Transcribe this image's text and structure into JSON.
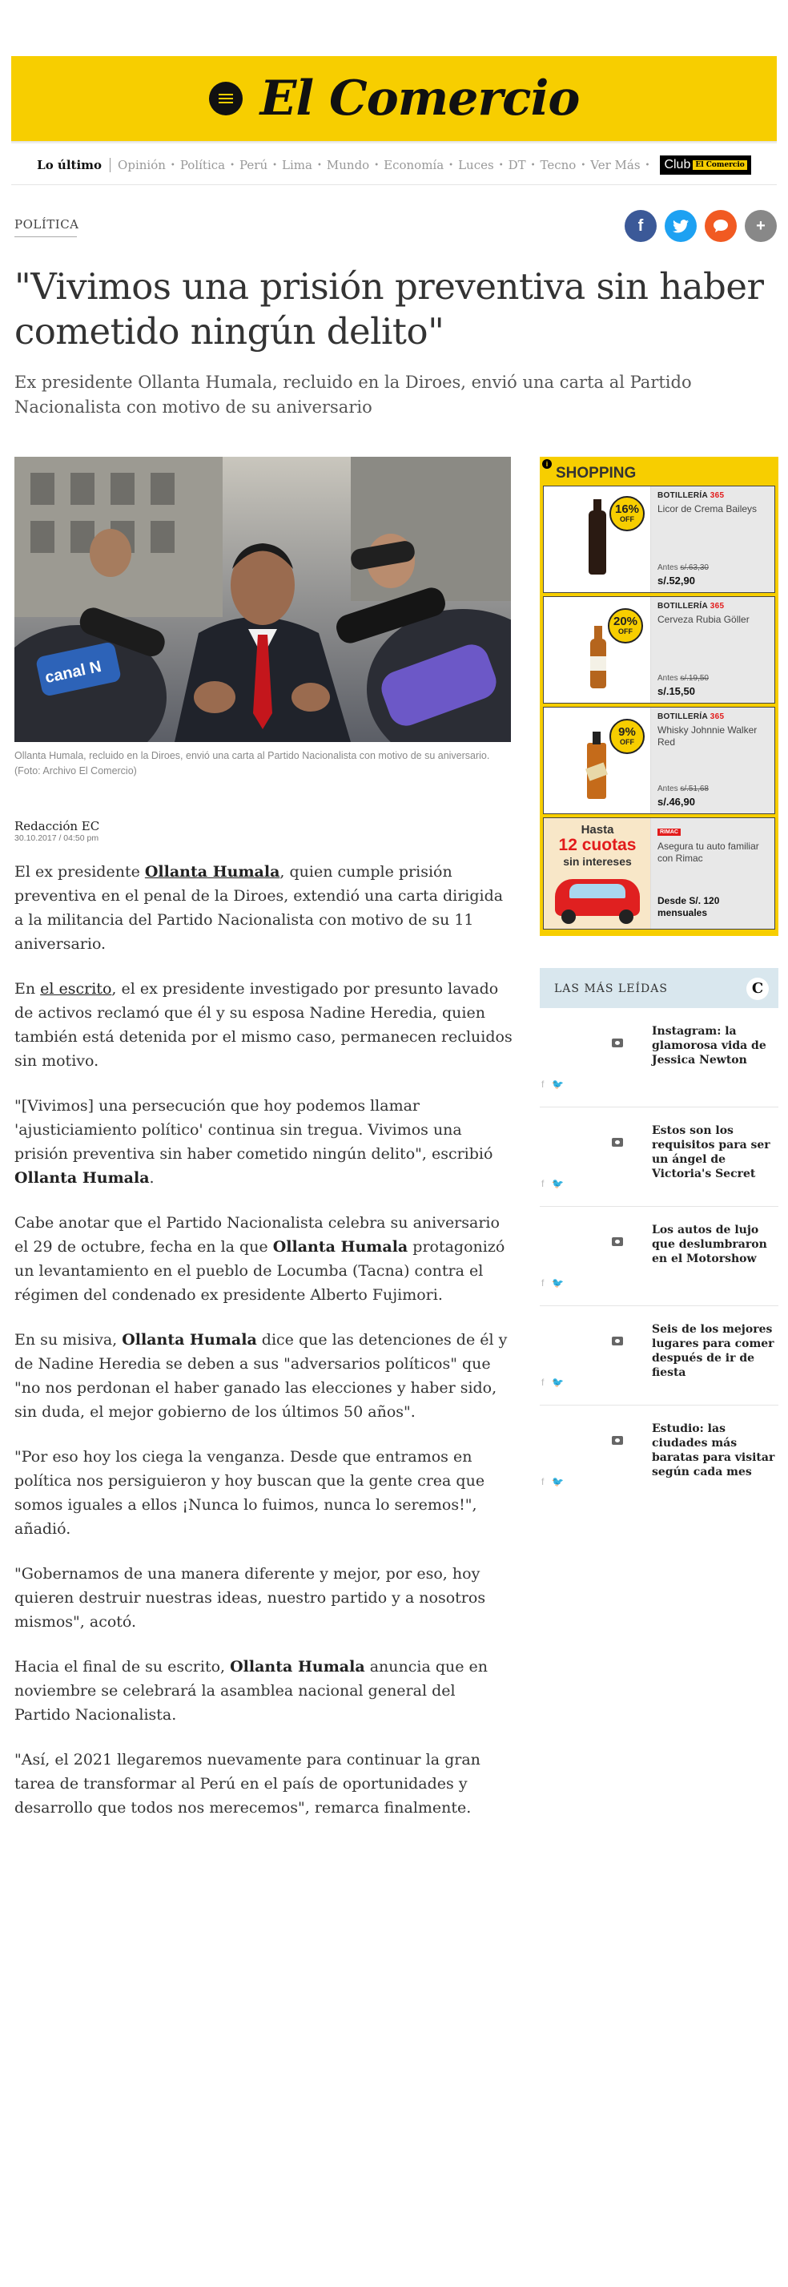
{
  "header": {
    "logo": "El Comercio"
  },
  "nav": {
    "lo_ultimo": "Lo último",
    "items": [
      "Opinión",
      "Política",
      "Perú",
      "Lima",
      "Mundo",
      "Economía",
      "Luces",
      "DT",
      "Tecno",
      "Ver Más"
    ],
    "club": "Club",
    "club_sub": "El Comercio"
  },
  "article": {
    "section": "POLÍTICA",
    "title": "\"Vivimos una prisión preventiva sin haber cometido ningún delito\"",
    "subtitle": "Ex presidente Ollanta Humala, recluido en la Diroes, envió una carta al Partido Nacionalista con motivo de su aniversario",
    "caption": "Ollanta Humala, recluido en la Diroes, envió una carta al Partido Nacionalista con motivo de su aniversario. (Foto: Archivo El Comercio)",
    "image_badge": "canal N",
    "author": "Redacción EC",
    "date": "30.10.2017 / 04:50 pm",
    "p1_a": "El ex presidente ",
    "p1_link": "Ollanta Humala",
    "p1_b": ", quien cumple prisión preventiva en el penal de la Diroes, extendió una carta dirigida a la militancia del Partido Nacionalista con motivo de su 11 aniversario.",
    "p2_a": "En ",
    "p2_link": "el escrito",
    "p2_b": ", el ex presidente investigado por presunto lavado de activos reclamó que él y su esposa Nadine Heredia, quien también está detenida por el mismo caso, permanecen recluidos sin motivo.",
    "p3_a": "\"[Vivimos] una persecución que hoy podemos llamar 'ajusticiamiento político' continua sin tregua. Vivimos una prisión preventiva sin haber cometido ningún delito\", escribió ",
    "p3_bold": "Ollanta Humala",
    "p3_b": ".",
    "p4_a": "Cabe anotar que el Partido Nacionalista celebra su aniversario el 29 de octubre, fecha en la que ",
    "p4_bold": "Ollanta Humala",
    "p4_b": " protagonizó un levantamiento en el pueblo de Locumba (Tacna) contra el régimen del condenado ex presidente Alberto Fujimori.",
    "p5_a": "En su misiva, ",
    "p5_bold": "Ollanta Humala",
    "p5_b": " dice que las detenciones de él y de Nadine Heredia se deben a sus \"adversarios políticos\" que \"no nos perdonan el haber ganado las elecciones y haber sido, sin duda, el mejor gobierno de los últimos 50 años\".",
    "p6": "\"Por eso hoy los ciega la venganza. Desde que entramos en política nos persiguieron y hoy buscan que la gente crea que somos iguales a ellos ¡Nunca lo fuimos, nunca lo seremos!\", añadió.",
    "p7": "\"Gobernamos de una manera diferente y mejor, por eso, hoy quieren destruir nuestras ideas, nuestro partido y a nosotros mismos\", acotó.",
    "p8_a": "Hacia el final de su escrito, ",
    "p8_bold": "Ollanta Humala",
    "p8_b": " anuncia que en noviembre se celebrará la asamblea nacional general del Partido Nacionalista.",
    "p9": "\"Así, el 2021 llegaremos nuevamente para continuar la gran tarea de transformar al Perú en el país de oportunidades y desarrollo que todos nos merecemos\", remarca finalmente."
  },
  "shopping": {
    "title": "SHOPPING",
    "info": "i",
    "cards": [
      {
        "brand": "BOTILLERÍA",
        "brand_num": "365",
        "name": "Licor de Crema Baileys",
        "antes_label": "Antes ",
        "antes": "s/.63,30",
        "price": "s/.52,90",
        "off": "16%",
        "off_label": "OFF"
      },
      {
        "brand": "BOTILLERÍA",
        "brand_num": "365",
        "name": "Cerveza Rubia Göller",
        "antes_label": "Antes ",
        "antes": "s/.19,50",
        "price": "s/.15,50",
        "off": "20%",
        "off_label": "OFF"
      },
      {
        "brand": "BOTILLERÍA",
        "brand_num": "365",
        "name": "Whisky Johnnie Walker Red",
        "antes_label": "Antes ",
        "antes": "s/.51,68",
        "price": "s/.46,90",
        "off": "9%",
        "off_label": "OFF"
      }
    ],
    "rimac": {
      "tag": "RIMAC",
      "name": "Asegura tu auto familiar con Rimac",
      "price": "Desde S/. 120 mensuales",
      "promo_top": "Hasta",
      "promo_big": "12 cuotas",
      "promo_bottom": "sin intereses"
    }
  },
  "mas_leidas": {
    "title": "LAS MÁS LEÍDAS",
    "logo": "C",
    "items": [
      "Instagram: la glamorosa vida de Jessica Newton",
      "Estos son los requisitos para ser un ángel de Victoria's Secret",
      "Los autos de lujo que deslumbraron en el Motorshow",
      "Seis de los mejores lugares para comer después de ir de fiesta",
      "Estudio: las ciudades más baratas para visitar según cada mes"
    ],
    "fb": "f",
    "tw": "🐦"
  },
  "colors": {
    "brand_yellow": "#f7ce00",
    "facebook": "#3b5998",
    "twitter": "#1da1f2",
    "comment": "#f15a22",
    "more": "#888888"
  }
}
